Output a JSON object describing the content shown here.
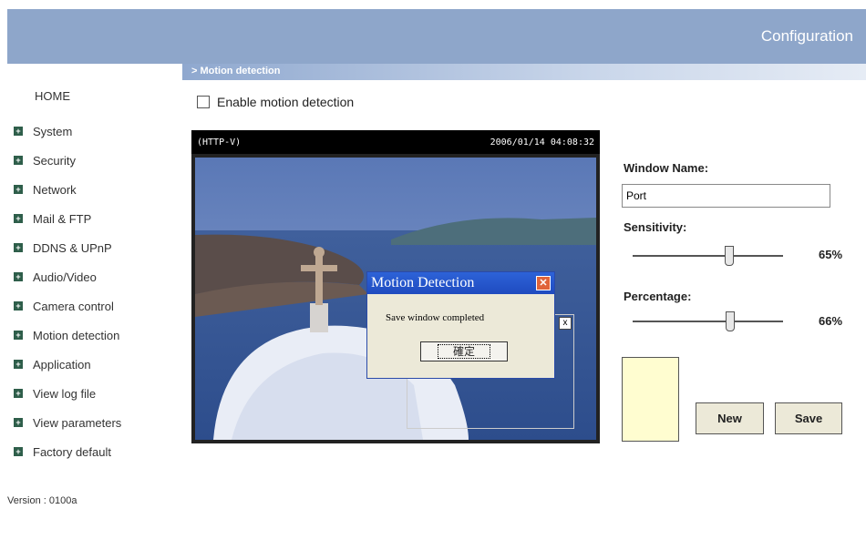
{
  "header": {
    "title": "Configuration",
    "bg": "#8ea6ca"
  },
  "sidebar": {
    "home_label": "HOME",
    "items": [
      {
        "label": "System"
      },
      {
        "label": "Security"
      },
      {
        "label": "Network"
      },
      {
        "label": "Mail & FTP"
      },
      {
        "label": "DDNS & UPnP"
      },
      {
        "label": "Audio/Video"
      },
      {
        "label": "Camera control"
      },
      {
        "label": "Motion detection"
      },
      {
        "label": "Application"
      },
      {
        "label": "View log file"
      },
      {
        "label": "View parameters"
      },
      {
        "label": "Factory default"
      }
    ],
    "version": "Version : 0100a"
  },
  "section": {
    "title": "> Motion detection"
  },
  "enable": {
    "label": "Enable motion detection",
    "checked": false
  },
  "video": {
    "name": "(HTTP-V)",
    "timestamp": "2006/01/14 04:08:32"
  },
  "dialog": {
    "title": "Motion Detection",
    "message": "Save window completed",
    "ok_label": "確定"
  },
  "motion_window": {
    "close_label": "x"
  },
  "form": {
    "window_name_label": "Window Name:",
    "window_name_value": "Port",
    "sensitivity_label": "Sensitivity:",
    "sensitivity_value": "65%",
    "sensitivity": 0.65,
    "percentage_label": "Percentage:",
    "percentage_value": "66%",
    "percentage": 0.66,
    "swatch_color": "#fffdd0",
    "new_label": "New",
    "save_label": "Save"
  }
}
